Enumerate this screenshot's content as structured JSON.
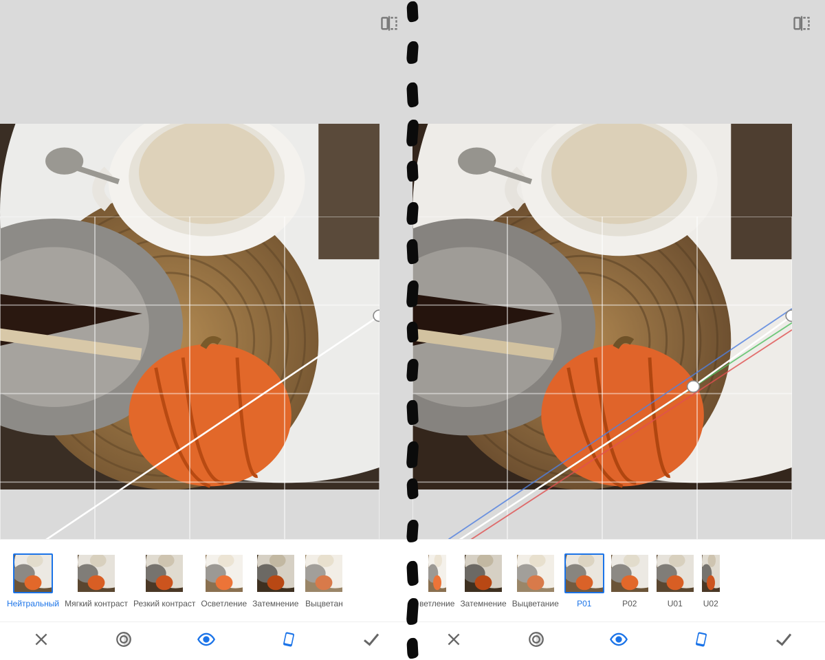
{
  "left": {
    "filters": [
      {
        "label": "Нейтральный",
        "selected": true
      },
      {
        "label": "Мягкий контраст",
        "selected": false
      },
      {
        "label": "Резкий контраст",
        "selected": false
      },
      {
        "label": "Осветление",
        "selected": false
      },
      {
        "label": "Затемнение",
        "selected": false
      },
      {
        "label": "Выцветан",
        "selected": false
      }
    ],
    "curve_points": [
      {
        "x": 1,
        "y": 0.28
      }
    ],
    "rgb_split": false
  },
  "right": {
    "filters": [
      {
        "label": "ветление",
        "selected": false,
        "partial": true
      },
      {
        "label": "Затемнение",
        "selected": false
      },
      {
        "label": "Выцветание",
        "selected": false
      },
      {
        "label": "P01",
        "selected": true
      },
      {
        "label": "P02",
        "selected": false
      },
      {
        "label": "U01",
        "selected": false
      },
      {
        "label": "U02",
        "selected": false,
        "partial": true
      }
    ],
    "curve_points": [
      {
        "x": 0.74,
        "y": 0.48
      },
      {
        "x": 1,
        "y": 0.28
      }
    ],
    "rgb_split": true
  },
  "tools": [
    {
      "name": "cancel",
      "active": false
    },
    {
      "name": "luminance",
      "active": false
    },
    {
      "name": "eye",
      "active": true
    },
    {
      "name": "phone",
      "active": true
    },
    {
      "name": "accept",
      "active": false
    }
  ]
}
